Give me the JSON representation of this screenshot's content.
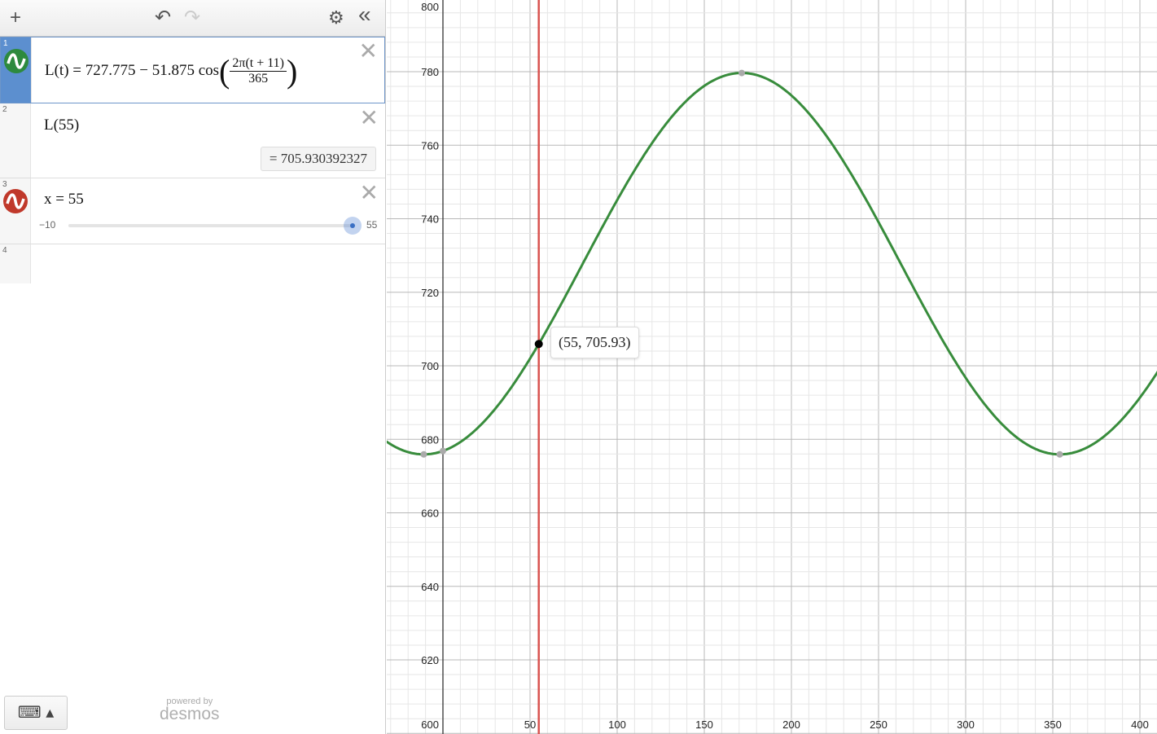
{
  "toolbar": {
    "add": "+",
    "undo": "↶",
    "redo": "↷",
    "settings": "⚙",
    "collapse": "«"
  },
  "expressions": [
    {
      "num": "1",
      "lhs": "L(t) = 727.775 − 51.875 cos",
      "frac_top": "2π(t + 11)",
      "frac_bottom": "365",
      "color": "#2d8a3e"
    },
    {
      "num": "2",
      "text": "L(55)",
      "result": "=  705.930392327"
    },
    {
      "num": "3",
      "text": "x = 55",
      "color": "#c0392b",
      "slider": {
        "min": "−10",
        "max": "55",
        "value": 55
      }
    },
    {
      "num": "4"
    }
  ],
  "footer": {
    "powered": "powered by",
    "brand": "desmos",
    "keyboard": "⌨ ▴"
  },
  "graph": {
    "tooltip": "(55, 705.93)",
    "curve_color": "#388c3c",
    "line_color": "#d9534f",
    "x_ticks": [
      "50",
      "100",
      "150",
      "200",
      "250",
      "300",
      "350",
      "400"
    ],
    "y_ticks": [
      "600",
      "620",
      "640",
      "660",
      "680",
      "700",
      "720",
      "740",
      "760",
      "780",
      "800"
    ]
  }
}
